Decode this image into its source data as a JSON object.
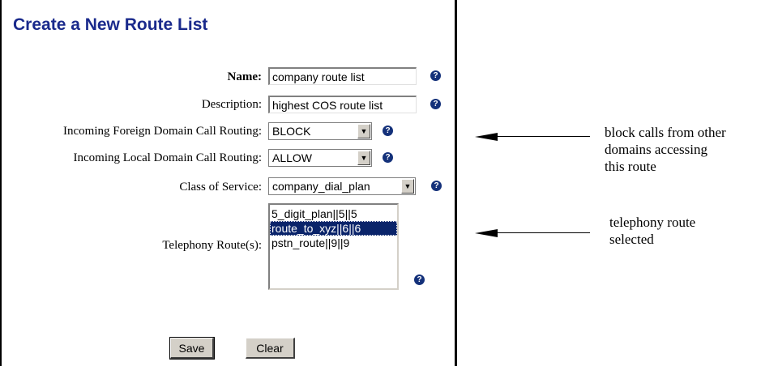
{
  "page": {
    "title": "Create a New Route List"
  },
  "form": {
    "name": {
      "label": "Name:",
      "value": "company route list"
    },
    "description": {
      "label": "Description:",
      "value": "highest COS route list"
    },
    "foreign_routing": {
      "label": "Incoming Foreign Domain Call Routing:",
      "value": "BLOCK"
    },
    "local_routing": {
      "label": "Incoming Local Domain Call Routing:",
      "value": "ALLOW"
    },
    "class_of_service": {
      "label": "Class of Service:",
      "value": "company_dial_plan"
    },
    "telephony_routes": {
      "label": "Telephony Route(s):",
      "options": [
        "5_digit_plan||5||5",
        "route_to_xyz||6||6",
        "pstn_route||9||9"
      ],
      "selected_index": 1
    },
    "help_glyph": "?",
    "dropdown_glyph": "▼"
  },
  "buttons": {
    "save": "Save",
    "clear": "Clear"
  },
  "annotations": {
    "foreign": [
      "block calls from other",
      "domains accessing",
      "this route"
    ],
    "telephony": [
      "telephony route",
      "selected"
    ]
  },
  "colors": {
    "title": "#1a2a8c",
    "selection": "#0a246a",
    "help_icon": "#14317a",
    "button_face": "#d4d0c8"
  }
}
